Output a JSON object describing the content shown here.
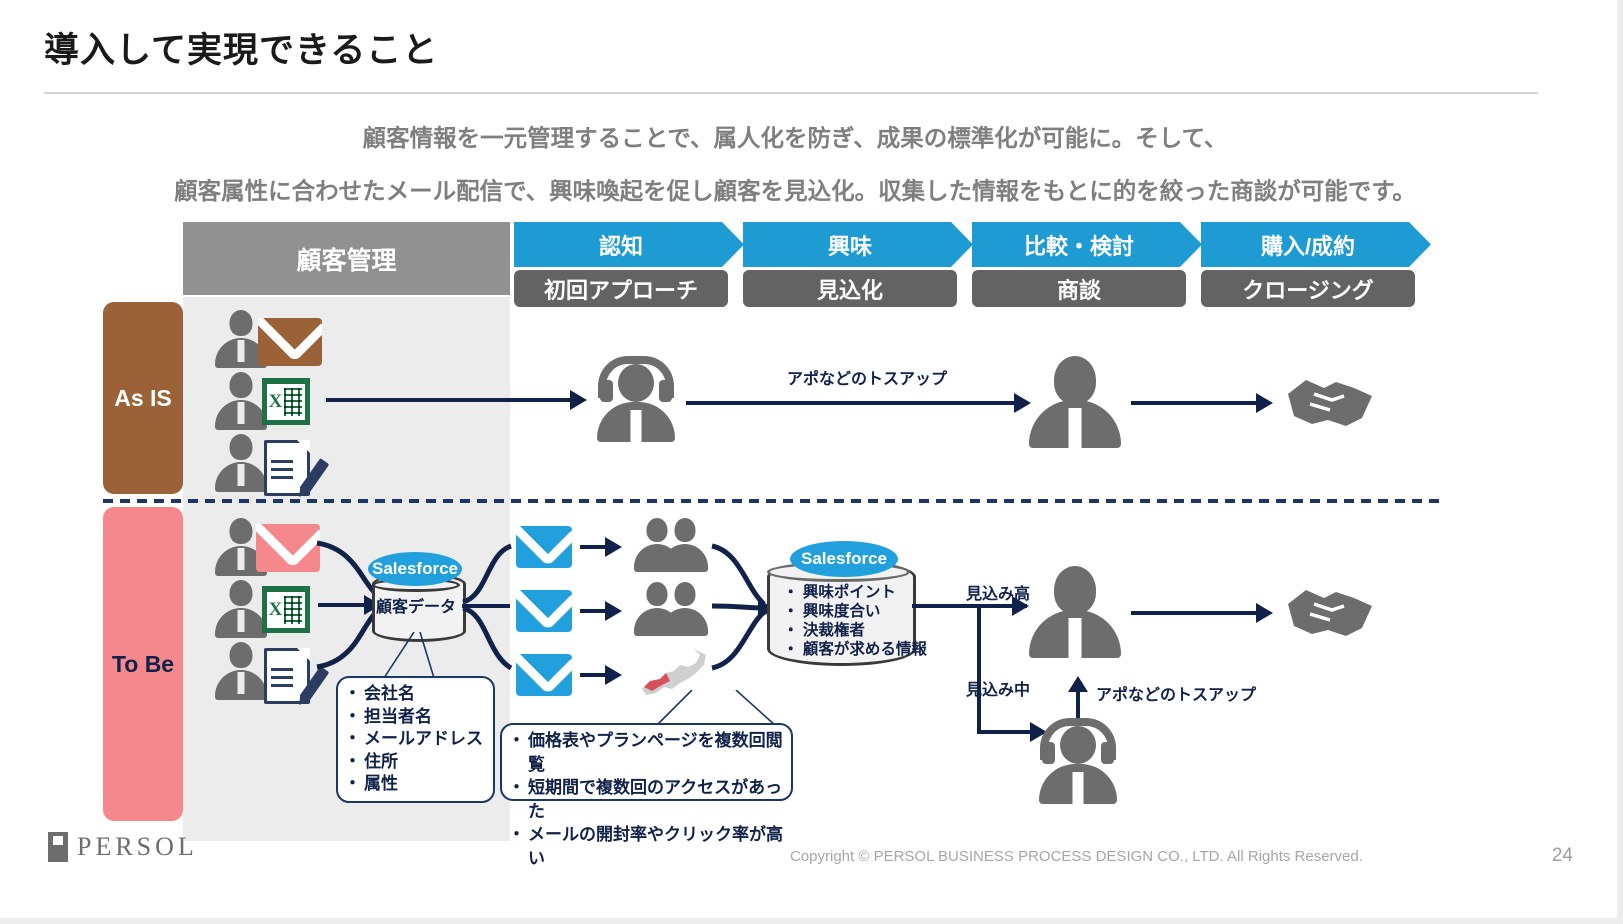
{
  "slide": {
    "title": "導入して実現できること",
    "page_number": "24",
    "copyright": "Copyright © PERSOL BUSINESS PROCESS DESIGN CO., LTD. All  Rights Reserved.",
    "logo_text": "PERSOL"
  },
  "subtitle": {
    "line1": "顧客情報を一元管理することで、属人化を防ぎ、成果の標準化が可能に。そして、",
    "line2": "顧客属性に合わせたメール配信で、興味喚起を促し顧客を見込化。収集した情報をもとに的を絞った商談が可能です。"
  },
  "stages": {
    "customer_management": "顧客管理",
    "items": [
      {
        "stage": "認知",
        "activity": "初回アプローチ"
      },
      {
        "stage": "興味",
        "activity": "見込化"
      },
      {
        "stage": "比較・検討",
        "activity": "商談"
      },
      {
        "stage": "購入/成約",
        "activity": "クロージング"
      }
    ]
  },
  "rows": {
    "as_is": "As IS",
    "to_be": "To Be"
  },
  "as_is_flow": {
    "toss_up_label": "アポなどのトスアップ"
  },
  "to_be_flow": {
    "crm_badge": "Salesforce",
    "crm_label": "顧客データ",
    "crm_fields": [
      "会社名",
      "担当者名",
      "メールアドレス",
      "住所",
      "属性"
    ],
    "behavior_signals": [
      "価格表やプランページを複数回閲覧",
      "短期間で複数回のアクセスがあった",
      "メールの開封率やクリック率が高い"
    ],
    "insight_badge": "Salesforce",
    "insight_items": [
      "興味ポイント",
      "興味度合い",
      "決裁権者",
      "顧客が求める情報"
    ],
    "lead_high_label": "見込み高",
    "lead_mid_label": "見込み中",
    "toss_up_label": "アポなどのトスアップ"
  },
  "colors": {
    "stage_blue": "#1f9bd4",
    "stage_gray": "#636363",
    "header_gray": "#919191",
    "as_is_brown": "#9a6236",
    "to_be_pink": "#f4888c",
    "navy": "#10224a",
    "mail_brown": "#9a6236",
    "mail_pink": "#f4888c",
    "mail_blue": "#22a0dd",
    "excel_green": "#1e7145",
    "person_gray": "#6d6d6d",
    "band_gray": "#ececec"
  }
}
